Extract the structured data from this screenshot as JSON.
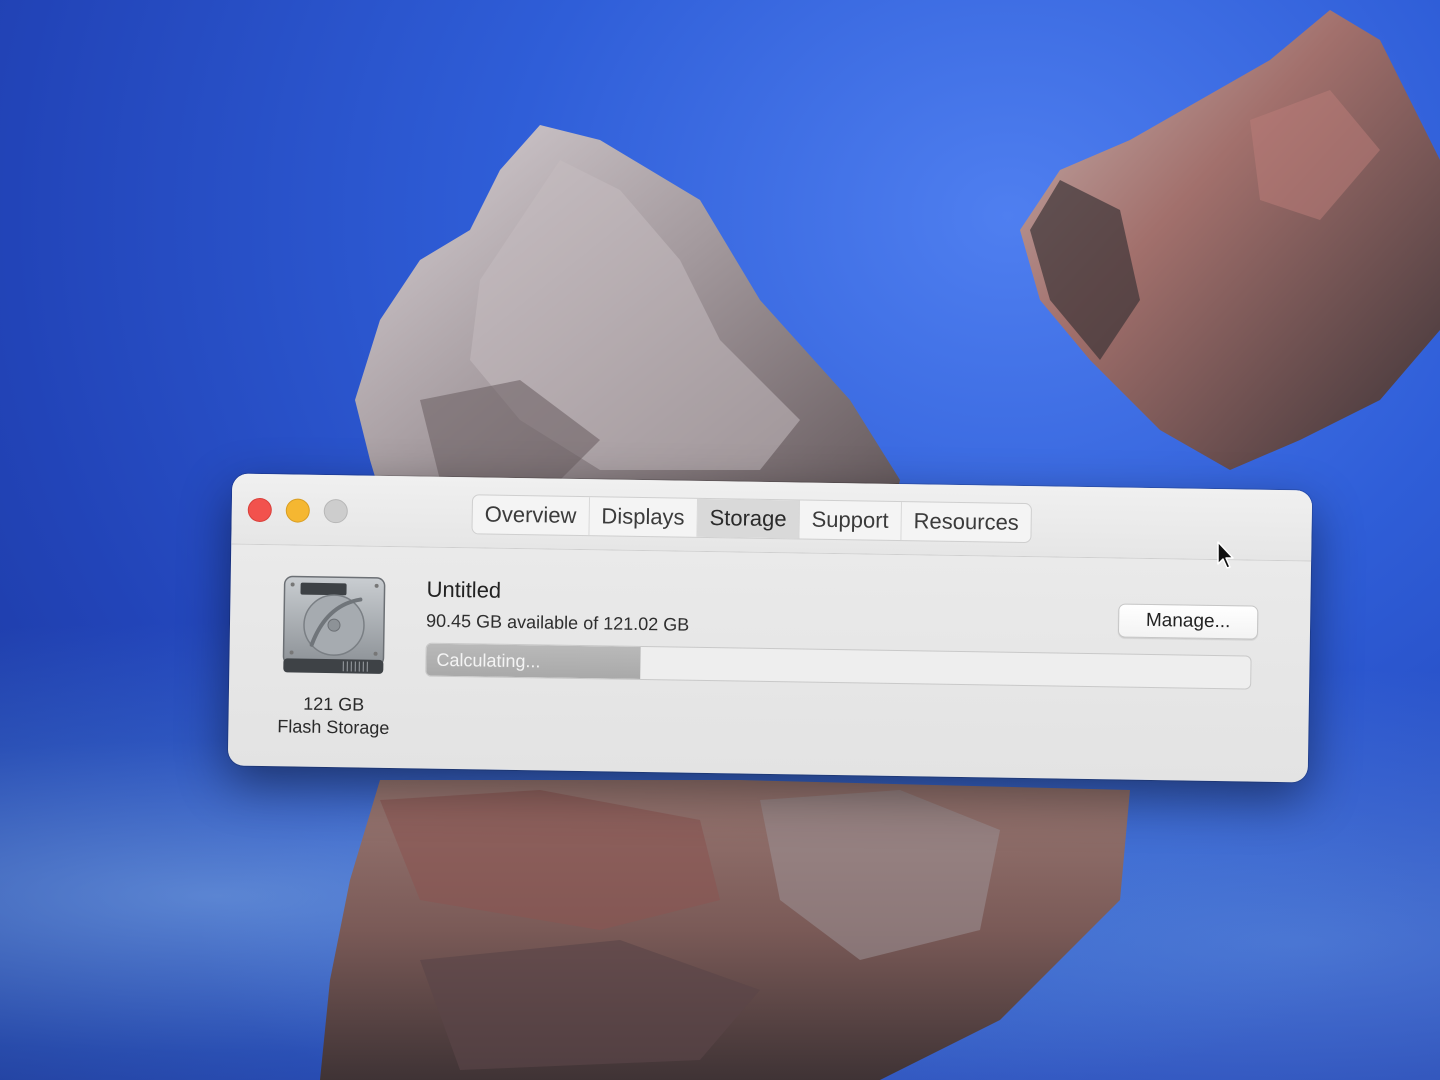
{
  "window": {
    "tabs": [
      {
        "label": "Overview",
        "active": false
      },
      {
        "label": "Displays",
        "active": false
      },
      {
        "label": "Storage",
        "active": true
      },
      {
        "label": "Support",
        "active": false
      },
      {
        "label": "Resources",
        "active": false
      }
    ]
  },
  "storage": {
    "drive_capacity": "121 GB",
    "drive_type": "Flash Storage",
    "volume_name": "Untitled",
    "availability": "90.45 GB available of 121.02 GB",
    "bar_label": "Calculating...",
    "bar_progress_percent": 26,
    "manage_label": "Manage..."
  },
  "colors": {
    "close": "#f2524d",
    "minimize": "#f5b731",
    "zoom_disabled": "#cdcdcd",
    "desktop_blue": "#2f5ed8"
  },
  "icons": {
    "drive": "hard-drive-icon",
    "cursor": "mouse-pointer-icon"
  }
}
